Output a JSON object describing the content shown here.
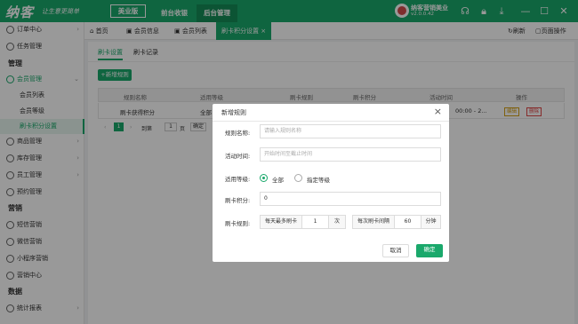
{
  "header": {
    "logo": "纳客",
    "slogan": "让生意更简单",
    "btn_primary": "美业版",
    "nav": [
      "前台收银",
      "后台管理"
    ],
    "user_name": "纳客营销美业",
    "user_version": "v2.0.0.42",
    "icons": [
      "headset-icon",
      "lock-icon",
      "download-icon",
      "minimize-icon",
      "maximize-icon",
      "close-icon"
    ]
  },
  "sidebar": {
    "items": [
      {
        "label": "订单中心",
        "type": "item",
        "icon": "order-icon",
        "arrow": "›"
      },
      {
        "label": "任务管理",
        "type": "item",
        "icon": "task-icon",
        "arrow": ""
      },
      {
        "label": "管理",
        "type": "section"
      },
      {
        "label": "会员管理",
        "type": "open",
        "icon": "member-icon",
        "arrow": "⌄"
      },
      {
        "label": "会员列表",
        "type": "sub"
      },
      {
        "label": "会员等级",
        "type": "sub"
      },
      {
        "label": "刷卡积分设置",
        "type": "sel"
      },
      {
        "label": "商品管理",
        "type": "item",
        "icon": "goods-icon",
        "arrow": "›"
      },
      {
        "label": "库存管理",
        "type": "item",
        "icon": "stock-icon",
        "arrow": "›"
      },
      {
        "label": "员工管理",
        "type": "item",
        "icon": "staff-icon",
        "arrow": "›"
      },
      {
        "label": "预约管理",
        "type": "item",
        "icon": "booking-icon",
        "arrow": ""
      },
      {
        "label": "营销",
        "type": "section"
      },
      {
        "label": "短信营销",
        "type": "item",
        "icon": "sms-icon",
        "arrow": ""
      },
      {
        "label": "微信营销",
        "type": "item",
        "icon": "wechat-icon",
        "arrow": ""
      },
      {
        "label": "小程序营销",
        "type": "item",
        "icon": "miniapp-icon",
        "arrow": ""
      },
      {
        "label": "营销中心",
        "type": "item",
        "icon": "marketing-icon",
        "arrow": ""
      },
      {
        "label": "数据",
        "type": "section"
      },
      {
        "label": "统计报表",
        "type": "item",
        "icon": "report-icon",
        "arrow": "›"
      }
    ]
  },
  "tabs": {
    "items": [
      "首页",
      "会员信息",
      "会员列表",
      "刷卡积分设置"
    ],
    "refresh": "刷新",
    "reset": "页面操作"
  },
  "content": {
    "subtabs": [
      "刷卡设置",
      "刷卡记录"
    ],
    "add_label": "+新增规则",
    "columns": [
      "规则名称",
      "适用等级",
      "刷卡规则",
      "刷卡积分",
      "活动时间",
      "操作"
    ],
    "row": {
      "name": "刷卡获得积分",
      "level": "全部",
      "time": "00:00 - 2...",
      "edit": "编辑",
      "del": "删除"
    },
    "pager": {
      "page": "1",
      "goto": "到第",
      "page_input": "1",
      "page_unit": "页",
      "confirm": "确定"
    }
  },
  "modal": {
    "title": "新增规则",
    "name_label": "规则名称:",
    "name_ph": "请输入规则名称",
    "time_label": "活动时间:",
    "time_ph": "开始时间至截止时间",
    "level_label": "适用等级:",
    "opt_all": "全部",
    "opt_spec": "指定等级",
    "points_label": "刷卡积分:",
    "points_value": "0",
    "rule_label": "刷卡规则:",
    "daily_max": "每天最多刷卡",
    "daily_val": "1",
    "times_unit": "次",
    "interval": "每次刷卡间隔",
    "interval_val": "60",
    "min_unit": "分钟",
    "cancel": "取消",
    "ok": "确定"
  },
  "colors": {
    "brand": "#1aa86b"
  }
}
